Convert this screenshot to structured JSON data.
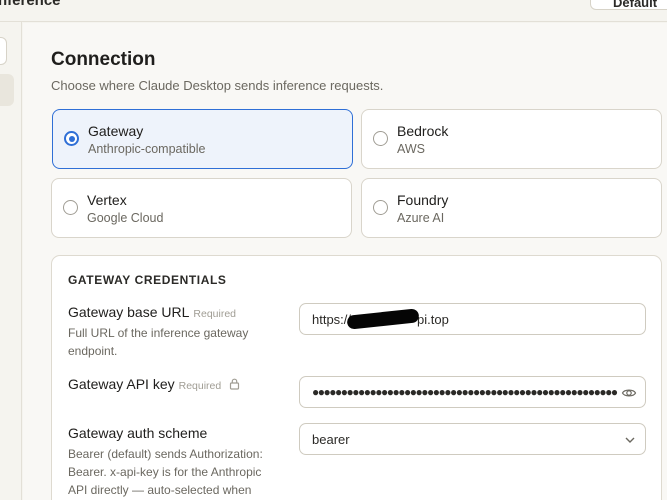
{
  "topbar": {
    "title": "nference",
    "button_label": "Default"
  },
  "connection": {
    "title": "Connection",
    "subtitle": "Choose where Claude Desktop sends inference requests.",
    "options": [
      {
        "label": "Gateway",
        "sub": "Anthropic-compatible",
        "selected": true
      },
      {
        "label": "Bedrock",
        "sub": "AWS",
        "selected": false
      },
      {
        "label": "Vertex",
        "sub": "Google Cloud",
        "selected": false
      },
      {
        "label": "Foundry",
        "sub": "Azure AI",
        "selected": false
      }
    ]
  },
  "credentials": {
    "heading": "GATEWAY CREDENTIALS",
    "required_label": "Required",
    "base_url": {
      "label": "Gateway base URL",
      "help": "Full URL of the inference gateway endpoint.",
      "value_prefix": "https://",
      "value_suffix": "pi.top"
    },
    "api_key": {
      "label": "Gateway API key",
      "masked_value": "●●●●●●●●●●●●●●●●●●●●●●●●●●●●●●●●●●●●●●●●●●●●●●●●●●●●●"
    },
    "auth_scheme": {
      "label": "Gateway auth scheme",
      "help": "Bearer (default) sends Authorization: Bearer. x-api-key is for the Anthropic API directly — auto-selected when",
      "value": "bearer"
    }
  },
  "icons": {
    "lock": "lock-icon",
    "eye": "eye-icon",
    "chevron": "chevron-down-icon"
  },
  "colors": {
    "accent": "#2f6fd6",
    "selected_bg": "#eef3fb"
  }
}
